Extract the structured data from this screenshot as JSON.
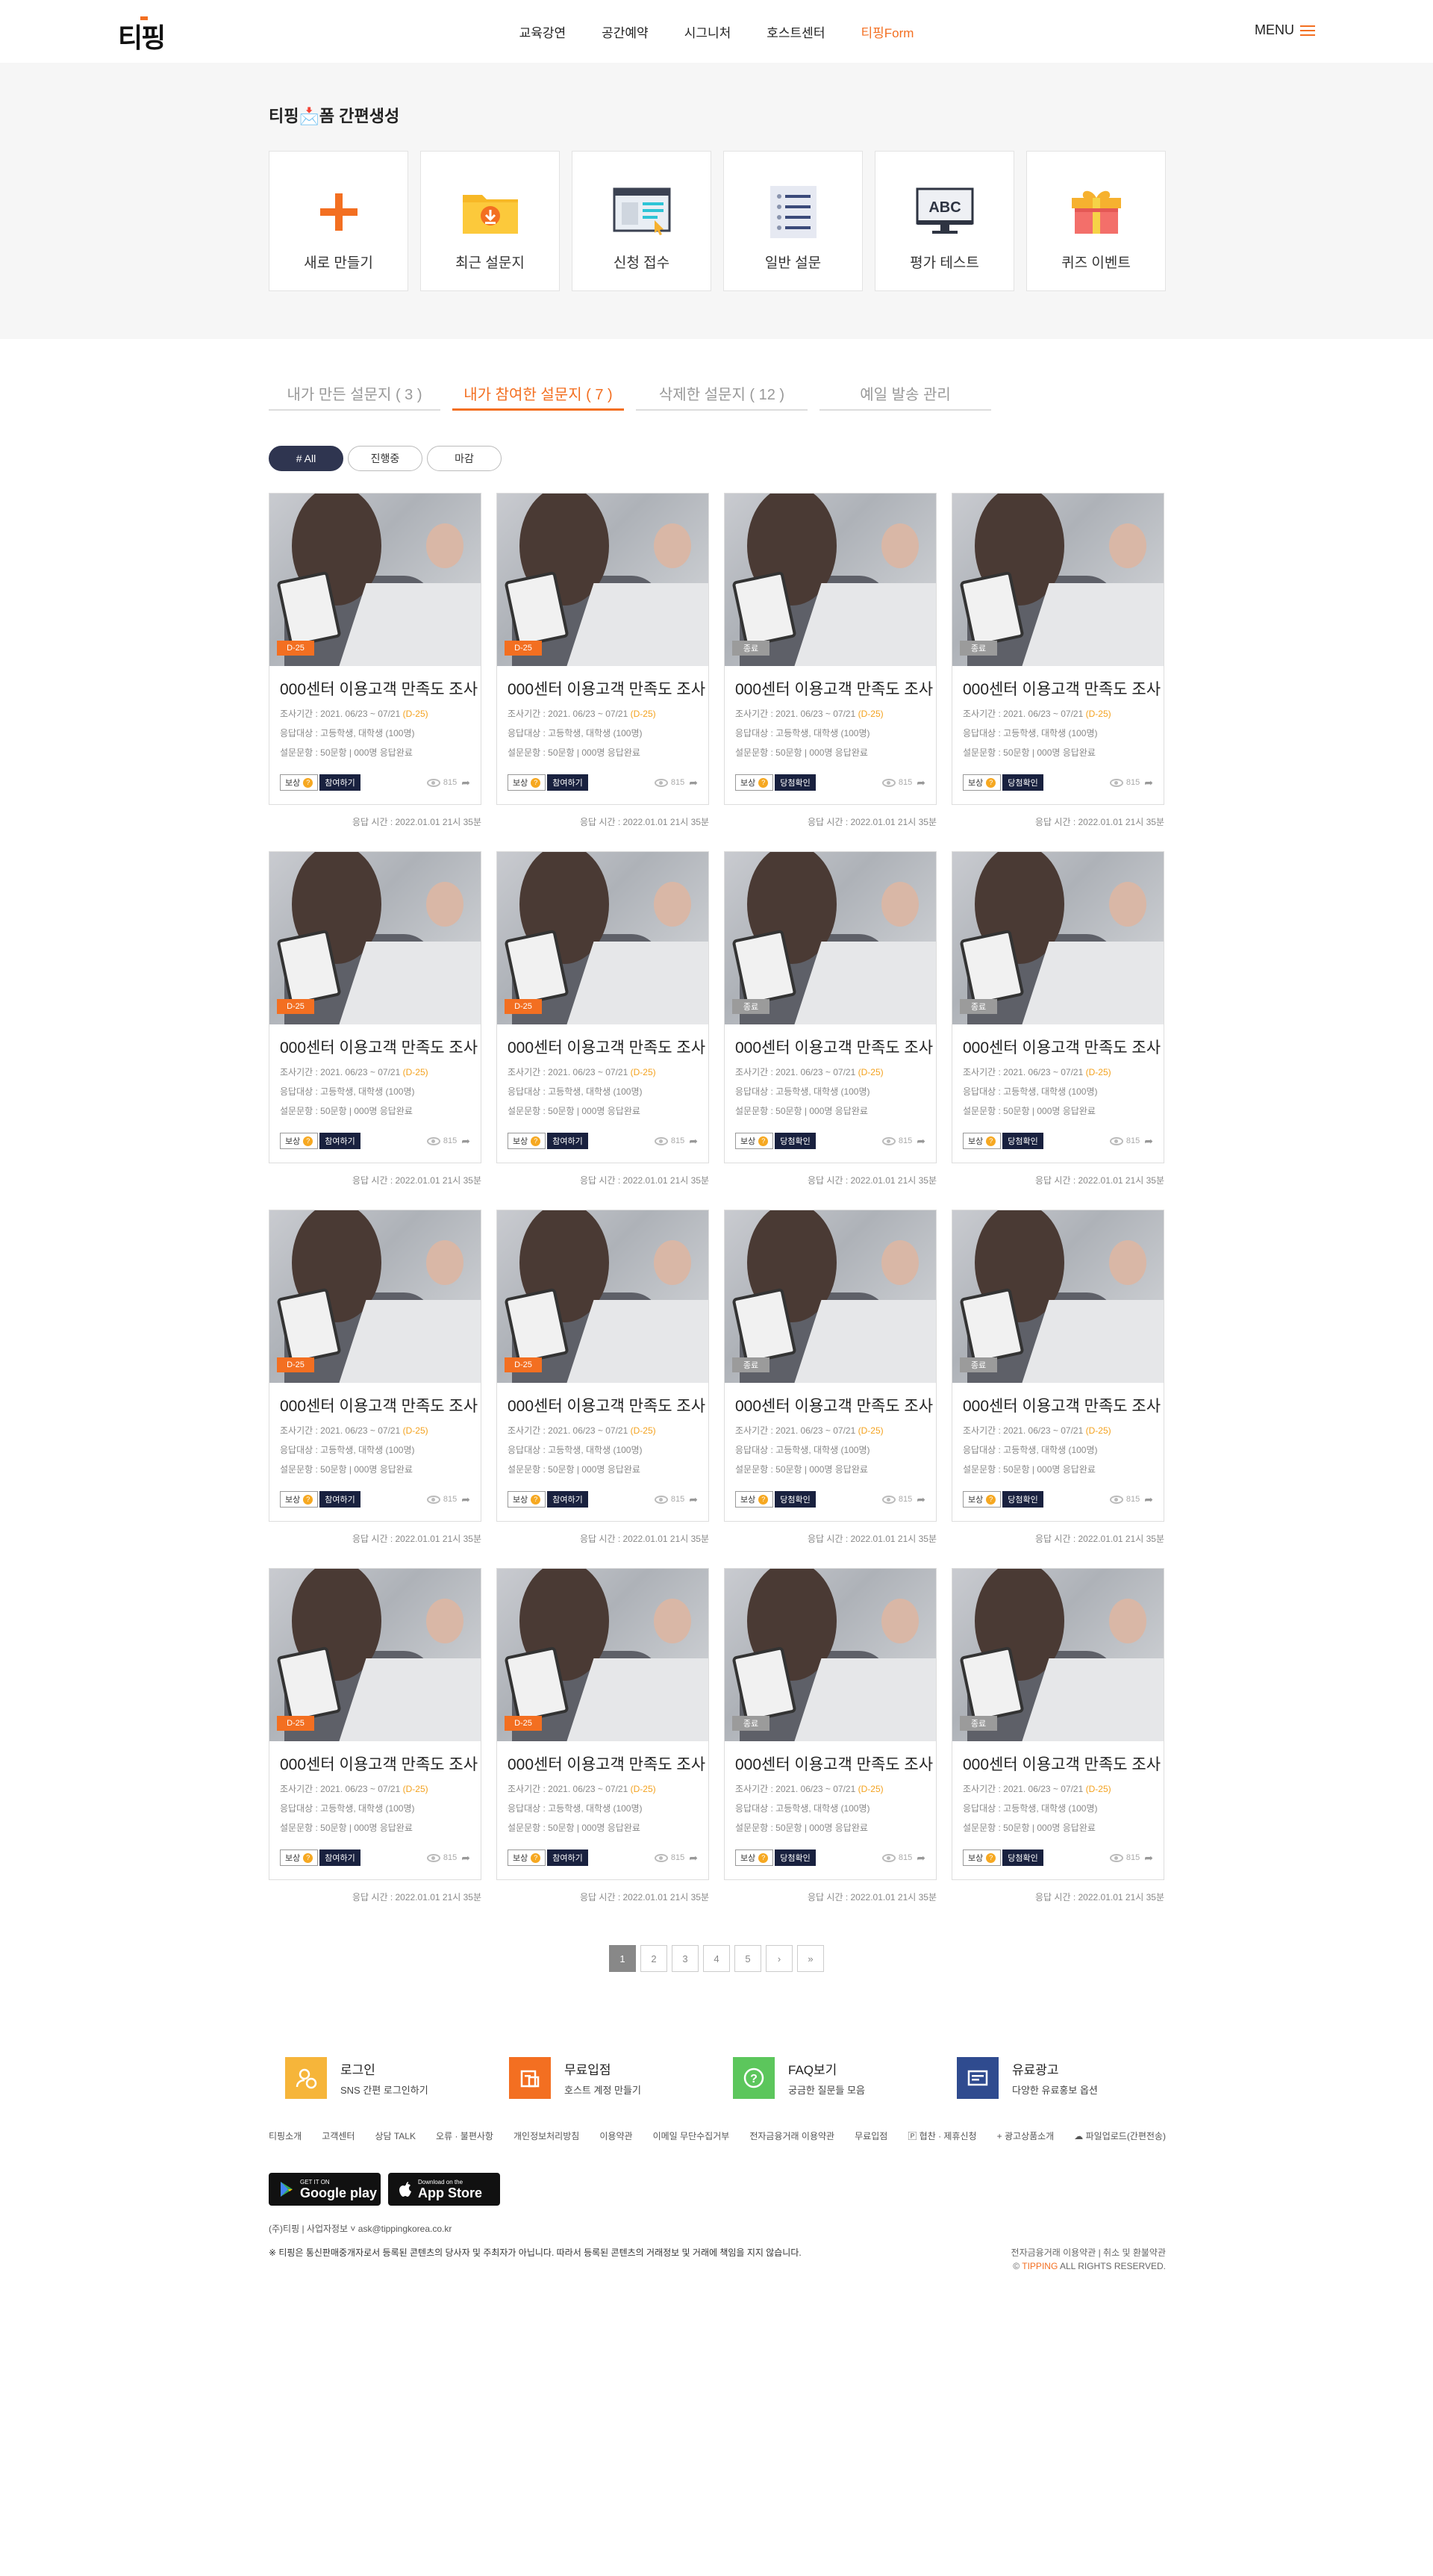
{
  "header": {
    "logo": "티핑",
    "nav": [
      "교육강연",
      "공간예약",
      "시그니처",
      "호스트센터",
      "티핑Form"
    ],
    "active_nav_index": 4,
    "menu_label": "MENU"
  },
  "generator": {
    "title": "티핑📩폼 간편생성",
    "cards": [
      {
        "label": "새로 만들기",
        "icon": "plus-icon"
      },
      {
        "label": "최근 설문지",
        "icon": "folder-download-icon"
      },
      {
        "label": "신청 접수",
        "icon": "form-window-icon"
      },
      {
        "label": "일반 설문",
        "icon": "checklist-icon"
      },
      {
        "label": "평가 테스트",
        "icon": "abc-monitor-icon"
      },
      {
        "label": "퀴즈 이벤트",
        "icon": "gift-box-icon"
      }
    ]
  },
  "tabs": [
    {
      "label": "내가 만든 설문지 ( 3 )"
    },
    {
      "label": "내가 참여한 설문지 ( 7 )"
    },
    {
      "label": "삭제한 설문지 ( 12 )"
    },
    {
      "label": "예일 발송 관리"
    }
  ],
  "active_tab_index": 1,
  "filters": [
    "# All",
    "진행중",
    "마감"
  ],
  "active_filter_index": 0,
  "cards_common": {
    "title": "000센터 이용고객 만족도 조사",
    "period_prefix": "조사기간 : 2021. 06/23 ~ 07/21 ",
    "period_dday": "(D-25)",
    "target": "응답대상 : 고등학생, 대학생 (100명)",
    "questions": "설문문항 : 50문항  |  000명 응답완료",
    "reward": "보상",
    "views": "815",
    "time": "응답 시간 : 2022.01.01 21시 35분"
  },
  "cards": [
    {
      "badge": "D-25",
      "status": "open",
      "action": "참여하기"
    },
    {
      "badge": "D-25",
      "status": "open",
      "action": "참여하기"
    },
    {
      "badge": "종료",
      "status": "closed",
      "action": "당첨확인"
    },
    {
      "badge": "종료",
      "status": "closed",
      "action": "당첨확인"
    },
    {
      "badge": "D-25",
      "status": "open",
      "action": "참여하기"
    },
    {
      "badge": "D-25",
      "status": "open",
      "action": "참여하기"
    },
    {
      "badge": "종료",
      "status": "closed",
      "action": "당첨확인"
    },
    {
      "badge": "종료",
      "status": "closed",
      "action": "당첨확인"
    },
    {
      "badge": "D-25",
      "status": "open",
      "action": "참여하기"
    },
    {
      "badge": "D-25",
      "status": "open",
      "action": "참여하기"
    },
    {
      "badge": "종료",
      "status": "closed",
      "action": "당첨확인"
    },
    {
      "badge": "종료",
      "status": "closed",
      "action": "당첨확인"
    },
    {
      "badge": "D-25",
      "status": "open",
      "action": "참여하기"
    },
    {
      "badge": "D-25",
      "status": "open",
      "action": "참여하기"
    },
    {
      "badge": "종료",
      "status": "closed",
      "action": "당첨확인"
    },
    {
      "badge": "종료",
      "status": "closed",
      "action": "당첨확인"
    }
  ],
  "pagination": {
    "pages": [
      "1",
      "2",
      "3",
      "4",
      "5"
    ],
    "next": "›",
    "last": "»",
    "current": "1"
  },
  "quick_links": [
    {
      "title": "로그인",
      "sub": "SNS 간편 로그인하기",
      "color": "#f6b53a",
      "icon": "login-icon"
    },
    {
      "title": "무료입점",
      "sub": "호스트 계정 만들기",
      "color": "#f36f21",
      "icon": "store-icon"
    },
    {
      "title": "FAQ보기",
      "sub": "궁금한 질문들 모음",
      "color": "#5cc65c",
      "icon": "question-icon"
    },
    {
      "title": "유료광고",
      "sub": "다양한 유료홍보 옵션",
      "color": "#2f4b8f",
      "icon": "ad-icon"
    }
  ],
  "footer_links": [
    "티핑소개",
    "고객센터",
    "상담 TALK",
    "오류 · 불편사항",
    "개인정보처리방침",
    "이용약관",
    "이메일 무단수집거부",
    "전자금융거래 이용약관",
    "무료입점",
    "🄿 협찬 · 제휴신청",
    "+ 광고상품소개",
    "☁ 파일업로드(간편전송)"
  ],
  "stores": [
    {
      "small": "GET IT ON",
      "big": "Google play",
      "icon": "google-play-icon"
    },
    {
      "small": "Download on the",
      "big": "App Store",
      "icon": "apple-icon"
    }
  ],
  "corp_info": "(주)티핑  |  사업자정보 ˅    ask@tippingkorea.co.kr",
  "notice": "※ 티핑은 통신판매중개자로서 등록된 콘텐츠의 당사자 및 주최자가 아닙니다. 따라서 등록된 콘텐츠의 거래정보 및 거래에 책임을 지지 않습니다.",
  "legal_links": "전자금융거래 이용약관    |    취소 및 환불약관",
  "copyright_prefix": "© ",
  "copyright_brand": "TIPPING",
  "copyright_suffix": " ALL RIGHTS RESERVED."
}
